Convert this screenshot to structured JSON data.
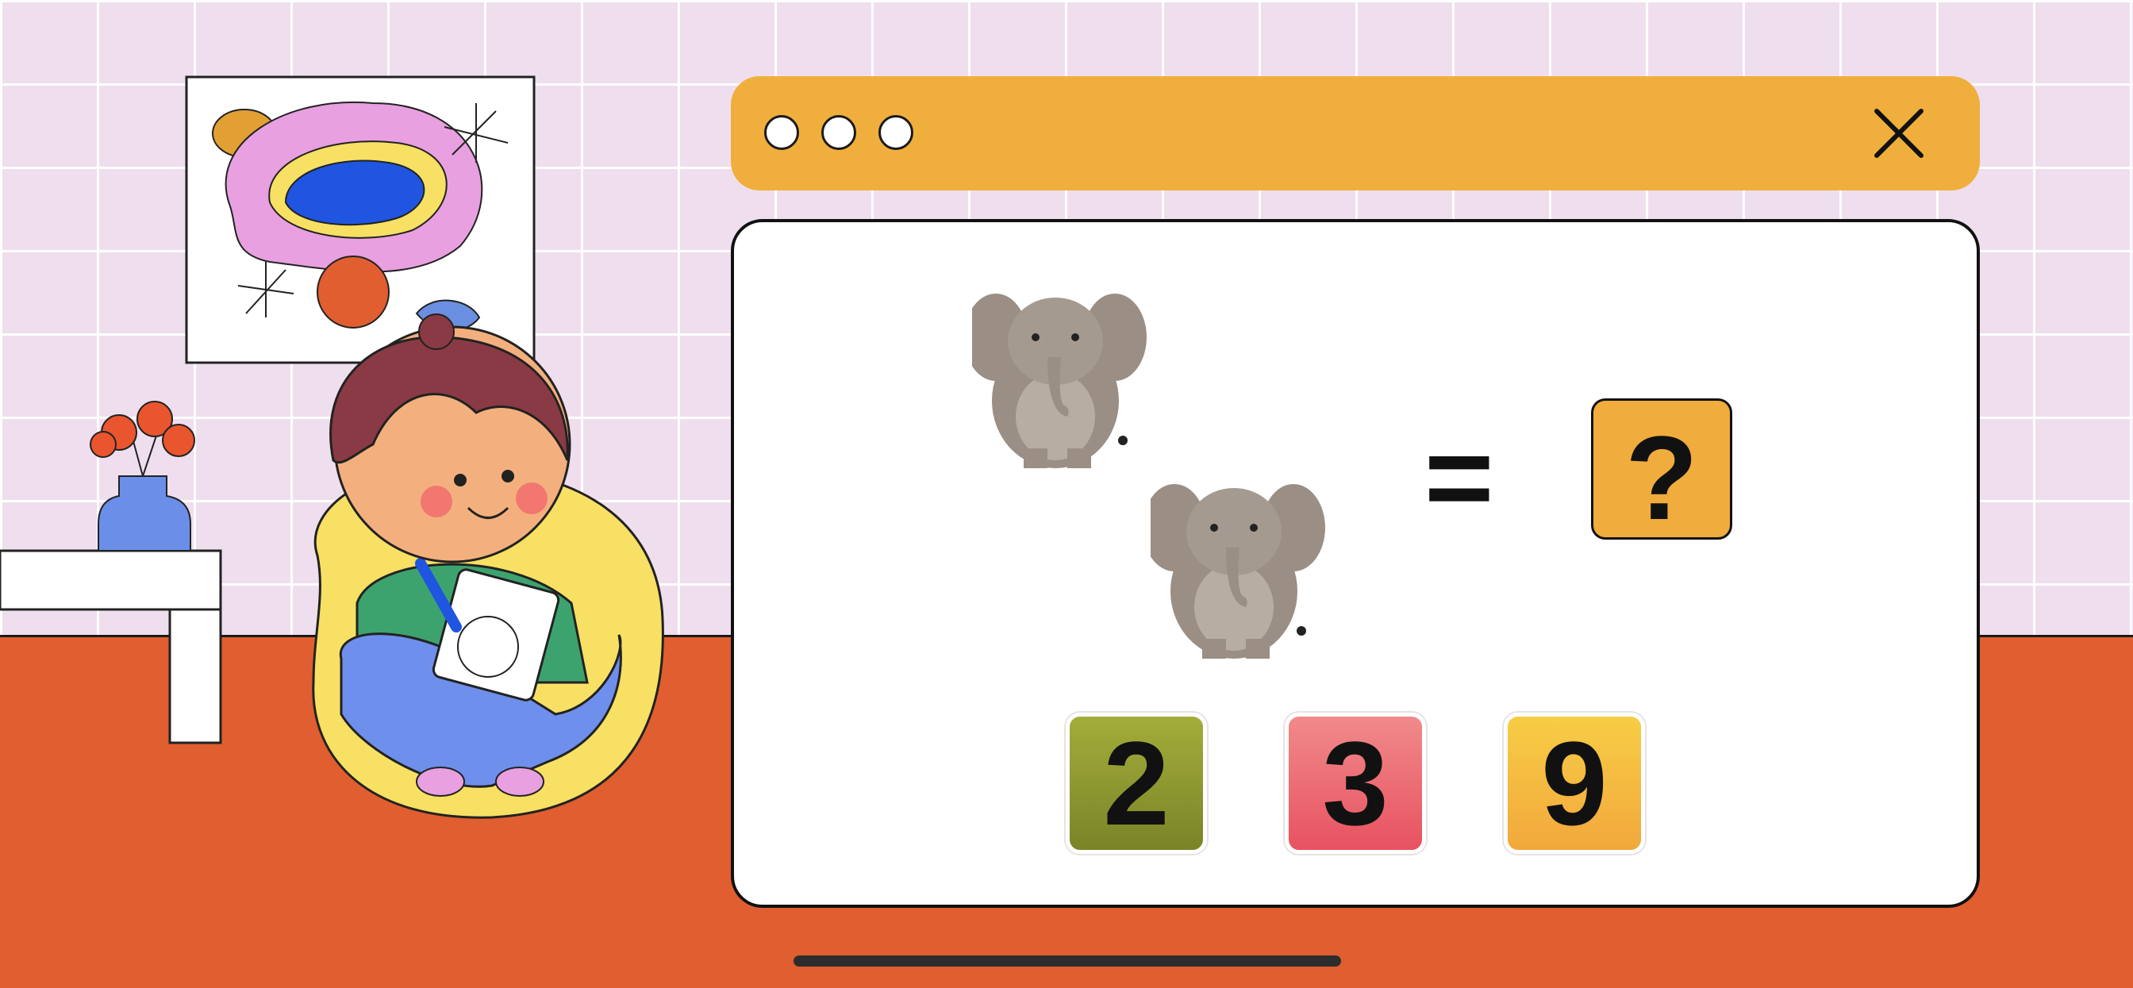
{
  "colors": {
    "bar": "#f0af3c",
    "floor": "#e05e30",
    "wall": "#efdfee",
    "question_box": "#f0ac3c",
    "choice_green": "#8a962e",
    "choice_red": "#e8606a",
    "choice_yellow": "#f4b83a"
  },
  "window": {
    "dots": [
      "dot-1",
      "dot-2",
      "dot-3"
    ],
    "close_icon": "close-icon"
  },
  "puzzle": {
    "items": [
      "elephant",
      "elephant"
    ],
    "operator": "=",
    "answer_placeholder": "?"
  },
  "choices": [
    {
      "label": "2",
      "color": "green"
    },
    {
      "label": "3",
      "color": "red"
    },
    {
      "label": "9",
      "color": "yellow"
    }
  ]
}
